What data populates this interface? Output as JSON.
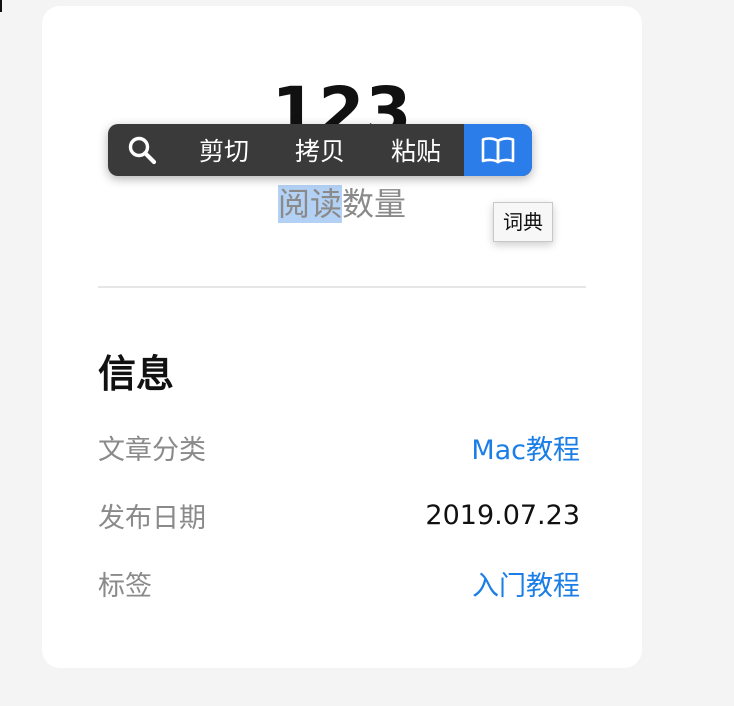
{
  "stats": {
    "read_count": "123",
    "read_label_selected": "阅读",
    "read_label_rest": "数量"
  },
  "context_menu": {
    "search_icon": "search-icon",
    "items": [
      "剪切",
      "拷贝",
      "粘贴"
    ],
    "dictionary_icon": "book-icon",
    "dictionary_tooltip": "词典"
  },
  "info": {
    "title": "信息",
    "rows": [
      {
        "label": "文章分类",
        "value": "Mac教程",
        "is_link": true
      },
      {
        "label": "发布日期",
        "value": "2019.07.23",
        "is_link": false
      },
      {
        "label": "标签",
        "value": "入门教程",
        "is_link": true
      }
    ]
  },
  "colors": {
    "link": "#1a7ee6",
    "selection": "#b3d1f5",
    "menu_bg": "#3a3a3a",
    "menu_active": "#2b7de9"
  }
}
